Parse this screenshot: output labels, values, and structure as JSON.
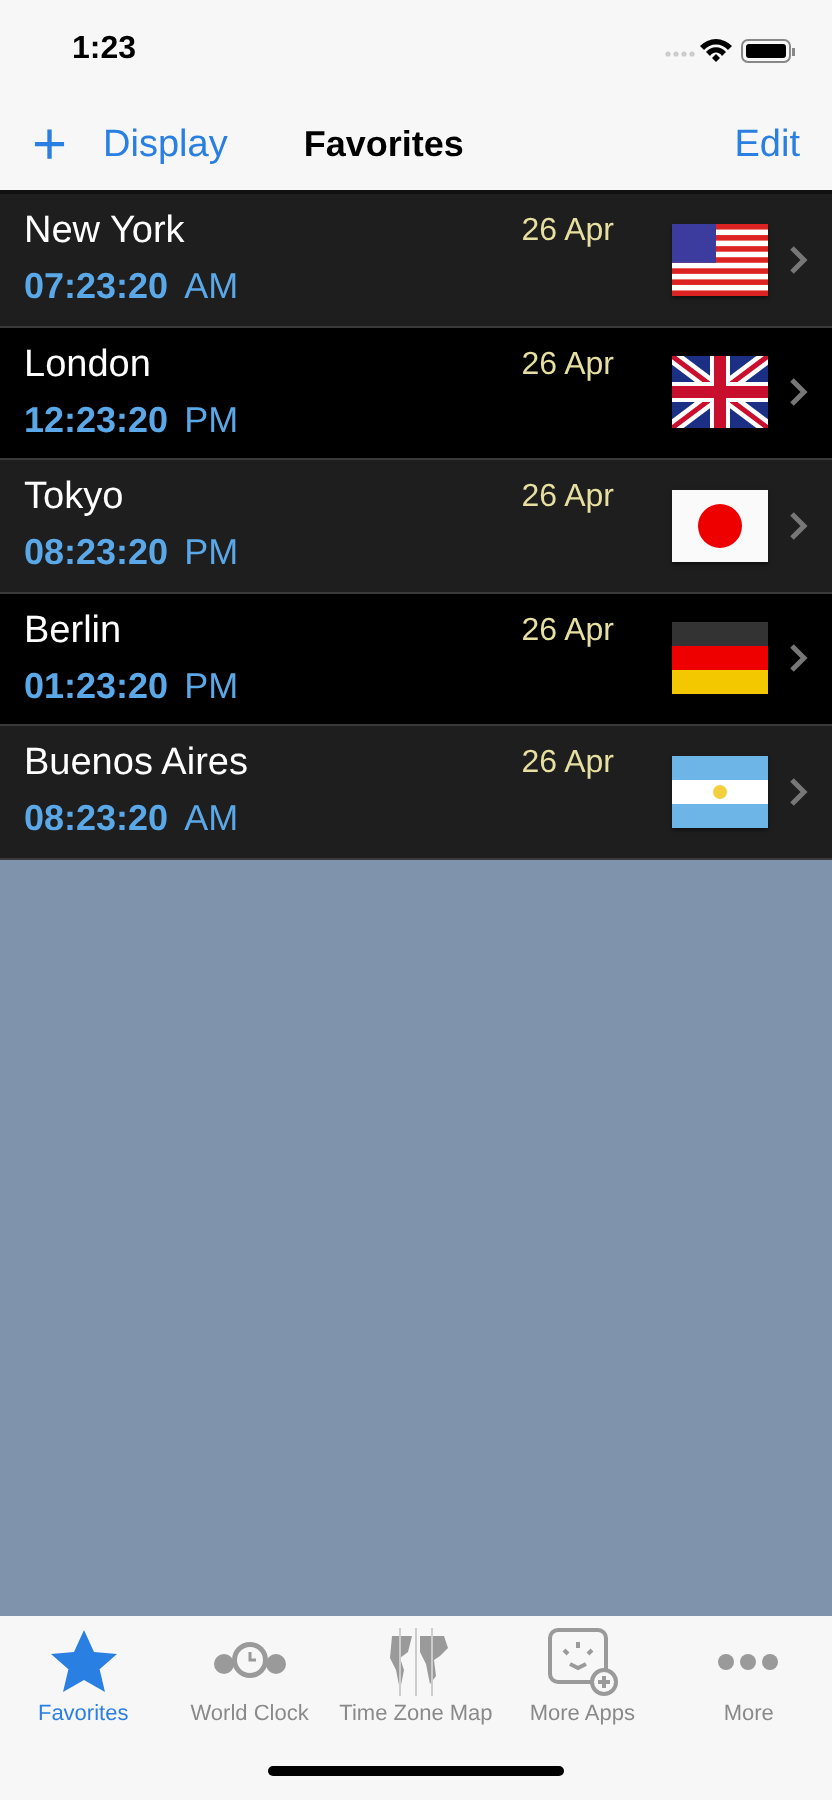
{
  "status_bar": {
    "time": "1:23"
  },
  "nav": {
    "add": "+",
    "display": "Display",
    "title": "Favorites",
    "edit": "Edit"
  },
  "cities": [
    {
      "name": "New York",
      "date": "26 Apr",
      "time": "07:23:20",
      "period": "AM",
      "kind": "us"
    },
    {
      "name": "London",
      "date": "26 Apr",
      "time": "12:23:20",
      "period": "PM",
      "kind": "uk"
    },
    {
      "name": "Tokyo",
      "date": "26 Apr",
      "time": "08:23:20",
      "period": "PM",
      "kind": "jp"
    },
    {
      "name": "Berlin",
      "date": "26 Apr",
      "time": "01:23:20",
      "period": "PM",
      "kind": "de"
    },
    {
      "name": "Buenos Aires",
      "date": "26 Apr",
      "time": "08:23:20",
      "period": "AM",
      "kind": "ar"
    }
  ],
  "tab_bar": [
    {
      "label": "Favorites",
      "kind": "star",
      "selected": true
    },
    {
      "label": "World Clock",
      "kind": "clock",
      "selected": false
    },
    {
      "label": "Time Zone Map",
      "kind": "map",
      "selected": false
    },
    {
      "label": "More Apps",
      "kind": "apps",
      "selected": false
    },
    {
      "label": "More",
      "kind": "more",
      "selected": false
    }
  ]
}
